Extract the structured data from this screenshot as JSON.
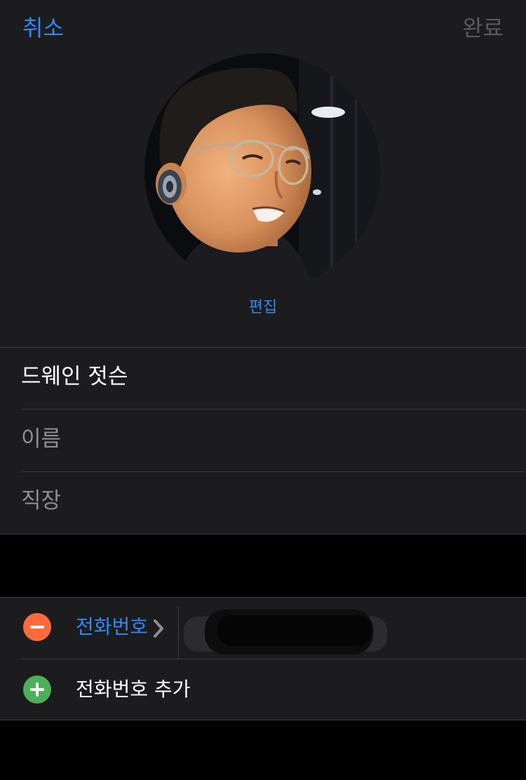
{
  "nav": {
    "cancel_label": "취소",
    "done_label": "완료"
  },
  "photo": {
    "edit_label": "편집"
  },
  "name_fields": {
    "full_name_value": "드웨인 젓슨",
    "first_name_placeholder": "이름",
    "company_placeholder": "직장"
  },
  "phone_section": {
    "phone_label": "전화번호",
    "add_phone_label": "전화번호 추가"
  },
  "colors": {
    "accent": "#2f88f5",
    "remove": "#ff6a3d",
    "add": "#4caf5a",
    "group_background": "#1c1c1e",
    "page_background": "#000000"
  },
  "icons": {
    "remove_button": "minus-circle-icon",
    "add_button": "plus-circle-icon",
    "disclosure": "chevron-right-icon"
  }
}
